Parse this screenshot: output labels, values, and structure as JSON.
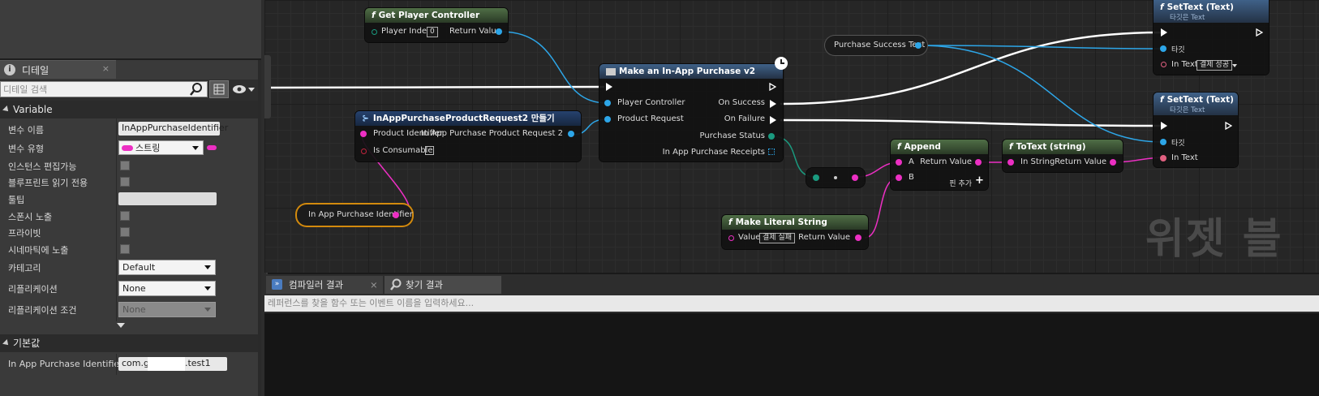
{
  "details_panel": {
    "tab_title": "디테일",
    "tab_close": "×",
    "search_placeholder": "디테일 검색",
    "variable_section": "Variable",
    "properties": [
      {
        "label": "변수 이름",
        "value": "InAppPurchaseIdentifier"
      },
      {
        "label": "변수 유형",
        "value": "스트링"
      },
      {
        "label": "인스턴스 편집가능"
      },
      {
        "label": "블루프린트 읽기 전용"
      },
      {
        "label": "툴팁"
      },
      {
        "label": "스폰시 노출"
      },
      {
        "label": "프라이빗"
      },
      {
        "label": "시네마틱에 노출"
      },
      {
        "label": "카테고리",
        "value": "Default"
      },
      {
        "label": "리플리케이션",
        "value": "None"
      },
      {
        "label": "리플리케이션 조건",
        "value": "None"
      }
    ],
    "default_section": "기본값",
    "default_row": {
      "label": "In App Purchase Identifier",
      "value_prefix": "com.g",
      "value_suffix": ".test1"
    }
  },
  "graph": {
    "watermark": "위젯 블",
    "nodes": {
      "get_player_controller": {
        "title": "Get Player Controller",
        "player_index_label": "Player Index",
        "player_index_value": "0",
        "return_value": "Return Value"
      },
      "make_purchase": {
        "title": "Make an In-App Purchase v2",
        "player_controller": "Player Controller",
        "product_request": "Product Request",
        "on_success": "On Success",
        "on_failure": "On Failure",
        "purchase_status": "Purchase Status",
        "receipts": "In App Purchase Receipts"
      },
      "make_request": {
        "title": "InAppPurchaseProductRequest2 만들기",
        "product_identifier": "Product Identifier",
        "is_consumable": "Is Consumable",
        "output": "In App Purchase Product Request 2"
      },
      "identifier_var": {
        "label": "In App Purchase Identifier"
      },
      "success_text_var": {
        "label": "Purchase Success Text"
      },
      "settext1": {
        "title": "SetText (Text)",
        "subtitle": "타깃은 Text",
        "target": "타깃",
        "in_text": "In Text",
        "in_text_value": "결제 성공"
      },
      "settext2": {
        "title": "SetText (Text)",
        "subtitle": "타깃은 Text",
        "target": "타깃",
        "in_text": "In Text"
      },
      "append": {
        "title": "Append",
        "a": "A",
        "b": "B",
        "return_value": "Return Value",
        "add_pin": "핀 추가"
      },
      "totext": {
        "title": "ToText (string)",
        "in_string": "In String",
        "return_value": "Return Value"
      },
      "make_literal": {
        "title": "Make Literal String",
        "value_label": "Value",
        "value": "결제 실패",
        "return_value": "Return Value"
      }
    }
  },
  "bottom_panel": {
    "tabs": [
      {
        "label": "컴파일러 결과"
      },
      {
        "label": "찾기 결과"
      }
    ],
    "find_placeholder": "레퍼런스를 찾을 함수 또는 이벤트 이름을 입력하세요..."
  },
  "colors": {
    "exec": "#ffffff",
    "object_pin": "#2da6e8",
    "string_pin": "#ec2fc3",
    "struct_pin": "#1a9a7f"
  }
}
